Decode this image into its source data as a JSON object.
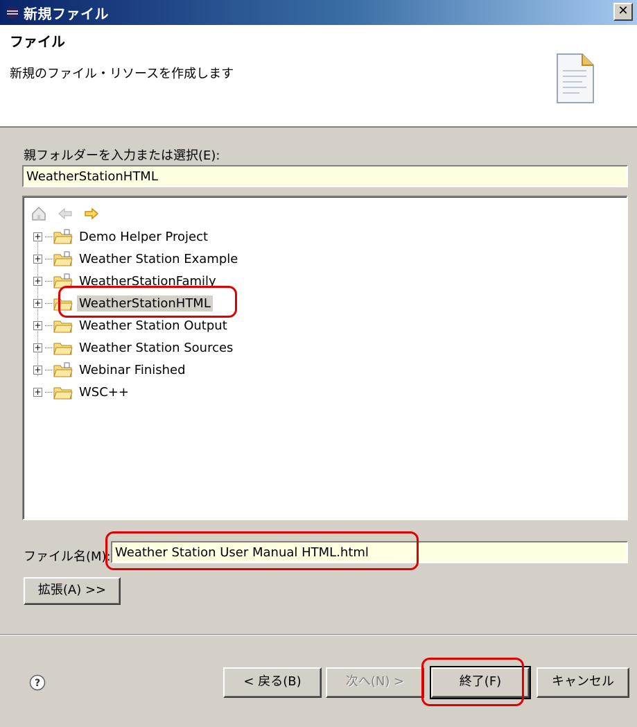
{
  "window": {
    "title": "新規ファイル",
    "close": "✕"
  },
  "header": {
    "title": "ファイル",
    "description": "新規のファイル・リソースを作成します"
  },
  "parent_folder": {
    "label": "親フォルダーを入力または選択(E):",
    "value": "WeatherStationHTML"
  },
  "tree": {
    "items": [
      {
        "label": "Demo Helper Project"
      },
      {
        "label": "Weather Station Example"
      },
      {
        "label": "WeatherStationFamily"
      },
      {
        "label": "WeatherStationHTML",
        "selected": true
      },
      {
        "label": "Weather Station Output"
      },
      {
        "label": "Weather Station Sources"
      },
      {
        "label": "Webinar Finished"
      },
      {
        "label": "WSC++"
      }
    ]
  },
  "filename": {
    "label": "ファイル名(M):",
    "value": "Weather Station User Manual HTML.html"
  },
  "buttons": {
    "advanced": "拡張(A) >>",
    "back": "< 戻る(B)",
    "next": "次へ(N) >",
    "finish": "終了(F)",
    "cancel": "キャンセル"
  },
  "colors": {
    "annotation": "#e00000",
    "field_background": "#ffffe1",
    "dialog": "#d4d0c8"
  }
}
